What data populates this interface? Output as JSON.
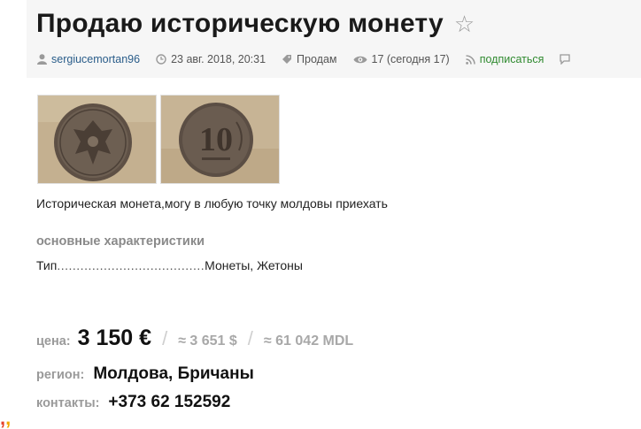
{
  "title": "Продаю историческую монету",
  "meta": {
    "author": "sergiucemortan96",
    "date": "23 авг. 2018, 20:31",
    "category": "Продам",
    "views": "17 (сегодня 17)",
    "subscribe": "подписаться"
  },
  "icons": {
    "favorite": "star-outline-icon",
    "author": "user-icon",
    "date": "clock-icon",
    "category": "tag-icon",
    "views": "eye-icon",
    "subscribe": "rss-icon",
    "extra": "comment-icon"
  },
  "description": "Историческая монета,могу в любую точку молдовы приехать",
  "specs": {
    "section_title": "основные характеристики",
    "items": [
      {
        "label": "Тип",
        "dots": "......................................",
        "value": "Монеты, Жетоны"
      }
    ]
  },
  "price": {
    "label": "цена:",
    "main": "3 150 €",
    "alt_usd": "≈ 3 651 $",
    "alt_mdl": "≈ 61 042 MDL"
  },
  "region": {
    "label": "регион:",
    "value": "Молдова, Бричаны"
  },
  "contacts": {
    "label": "контакты:",
    "value": "+373 62 152592"
  },
  "colors": {
    "accent_link": "#2a5d8a",
    "subscribe": "#2f8a2f",
    "label_gray": "#9a9a9a"
  }
}
